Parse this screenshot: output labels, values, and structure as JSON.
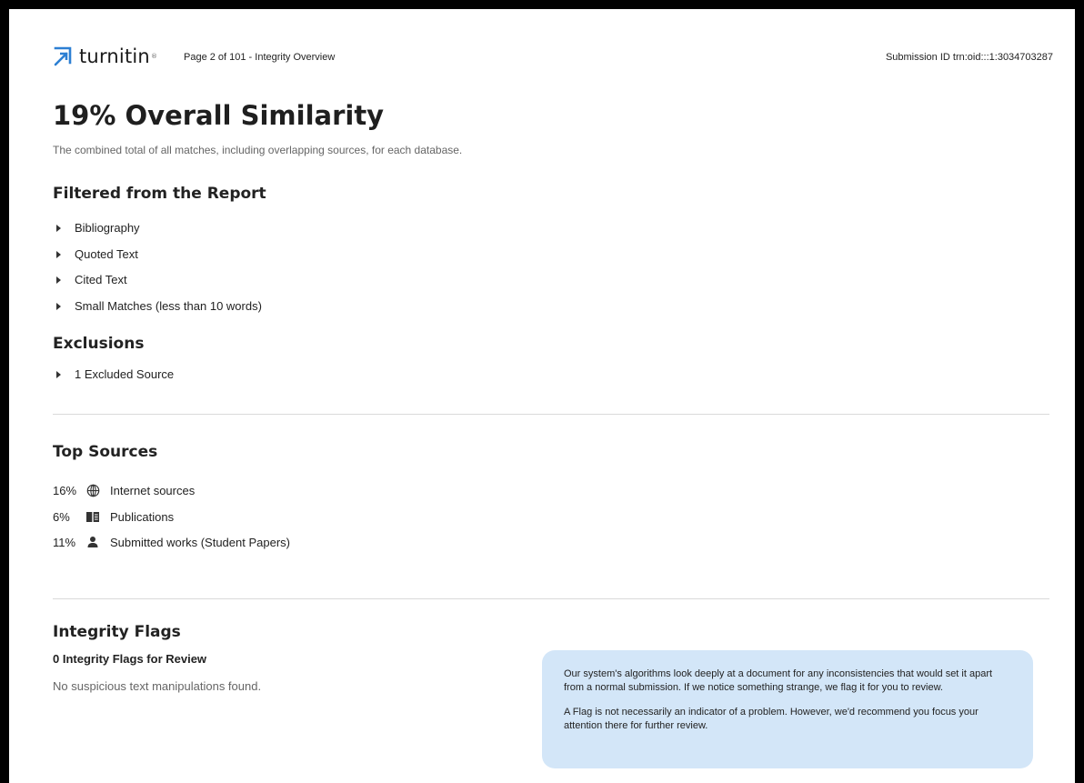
{
  "header": {
    "brand": "turnitin",
    "page_info": "Page 2 of 101 - Integrity Overview",
    "submission_id": "Submission ID trn:oid:::1:3034703287",
    "brand_color": "#2c7fd3"
  },
  "similarity": {
    "title": "19% Overall Similarity",
    "subtitle": "The combined total of all matches, including overlapping sources, for each database."
  },
  "filtered": {
    "heading": "Filtered from the Report",
    "items": [
      "Bibliography",
      "Quoted Text",
      "Cited Text",
      "Small Matches (less than 10 words)"
    ]
  },
  "exclusions": {
    "heading": "Exclusions",
    "items": [
      "1 Excluded Source"
    ]
  },
  "top_sources": {
    "heading": "Top Sources",
    "items": [
      {
        "percent": "16%",
        "icon": "globe-icon",
        "label": "Internet sources"
      },
      {
        "percent": "6%",
        "icon": "book-icon",
        "label": "Publications"
      },
      {
        "percent": "11%",
        "icon": "person-icon",
        "label": "Submitted works (Student Papers)"
      }
    ]
  },
  "integrity": {
    "heading": "Integrity Flags",
    "count_label": "0 Integrity Flags for Review",
    "status_text": "No suspicious text manipulations found.",
    "info_paragraph_1": "Our system's algorithms look deeply at a document for any inconsistencies that would set it apart from a normal submission. If we notice something strange, we flag it for you to review.",
    "info_paragraph_2": "A Flag is not necessarily an indicator of a problem. However, we'd recommend you focus your attention there for further review.",
    "info_bg_color": "#d3e6f8"
  }
}
